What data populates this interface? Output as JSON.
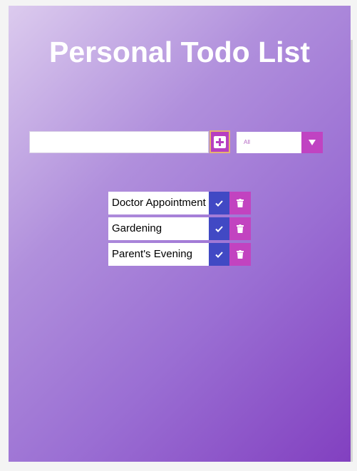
{
  "app": {
    "title": "Personal Todo List"
  },
  "form": {
    "input_value": "",
    "add_icon": "plus-square-icon",
    "filter": {
      "selected": "All",
      "arrow_icon": "caret-down-icon"
    }
  },
  "todos": [
    {
      "text": "Doctor Appointment"
    },
    {
      "text": "Gardening"
    },
    {
      "text": "Parent's Evening"
    }
  ],
  "icons": {
    "complete": "check-icon",
    "delete": "trash-icon"
  },
  "colors": {
    "gradient_start": "#dccbee",
    "gradient_end": "#8240c0",
    "accent_pink": "#c043c2",
    "accent_blue": "#4149c4",
    "add_border": "#e6b270"
  }
}
